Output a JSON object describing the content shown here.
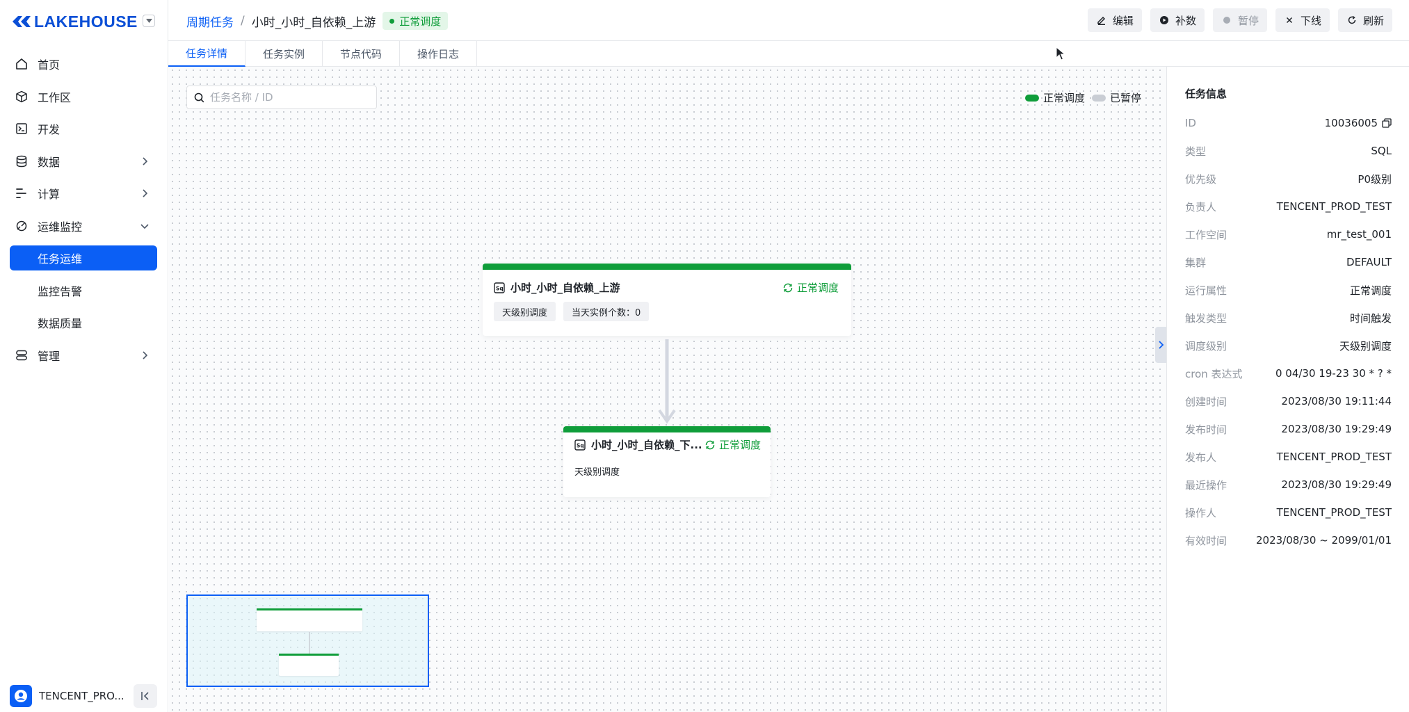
{
  "app": {
    "logo_text": "LAKEHOUSE"
  },
  "sidebar": {
    "items": [
      {
        "label": "首页",
        "icon": "home-icon"
      },
      {
        "label": "工作区",
        "icon": "cube-icon"
      },
      {
        "label": "开发",
        "icon": "terminal-icon"
      },
      {
        "label": "数据",
        "icon": "database-icon",
        "has_children": true
      },
      {
        "label": "计算",
        "icon": "compute-icon",
        "has_children": true
      },
      {
        "label": "运维监控",
        "icon": "monitor-icon",
        "expanded": true
      },
      {
        "label": "任务运维",
        "active": true
      },
      {
        "label": "监控告警"
      },
      {
        "label": "数据质量"
      },
      {
        "label": "管理",
        "icon": "manage-icon",
        "has_children": true
      }
    ],
    "user": {
      "name": "TENCENT_PRO..."
    }
  },
  "header": {
    "breadcrumb_parent": "周期任务",
    "breadcrumb_separator": "/",
    "breadcrumb_current": "小时_小时_自依赖_上游",
    "status_badge": "正常调度",
    "actions": [
      {
        "label": "编辑",
        "icon": "edit-icon"
      },
      {
        "label": "补数",
        "icon": "backfill-icon"
      },
      {
        "label": "暂停",
        "icon": "pause-icon",
        "disabled": true
      },
      {
        "label": "下线",
        "icon": "close-icon"
      },
      {
        "label": "刷新",
        "icon": "refresh-icon"
      }
    ]
  },
  "tabs": [
    {
      "label": "任务详情",
      "active": true
    },
    {
      "label": "任务实例"
    },
    {
      "label": "节点代码"
    },
    {
      "label": "操作日志"
    }
  ],
  "canvas": {
    "search_placeholder": "任务名称 / ID",
    "legend": [
      {
        "label": "正常调度",
        "color": "#0f9d3a"
      },
      {
        "label": "已暂停",
        "color": "#c9cdd4"
      }
    ],
    "nodes": [
      {
        "title": "小时_小时_自依赖_上游",
        "status": "正常调度",
        "chips": [
          "天级别调度",
          "当天实例个数：0"
        ]
      },
      {
        "title": "小时_小时_自依赖_下...",
        "status": "正常调度",
        "detail": "天级别调度"
      }
    ]
  },
  "task_info": {
    "title": "任务信息",
    "rows": [
      {
        "key": "ID",
        "value": "10036005",
        "copyable": true
      },
      {
        "key": "类型",
        "value": "SQL"
      },
      {
        "key": "优先级",
        "value": "P0级别"
      },
      {
        "key": "负责人",
        "value": "TENCENT_PROD_TEST"
      },
      {
        "key": "工作空间",
        "value": "mr_test_001"
      },
      {
        "key": "集群",
        "value": "DEFAULT"
      },
      {
        "key": "运行属性",
        "value": "正常调度"
      },
      {
        "key": "触发类型",
        "value": "时间触发"
      },
      {
        "key": "调度级别",
        "value": "天级别调度"
      },
      {
        "key": "cron 表达式",
        "value": "0 04/30 19-23 30 * ? *"
      },
      {
        "key": "创建时间",
        "value": "2023/08/30 19:11:44"
      },
      {
        "key": "发布时间",
        "value": "2023/08/30 19:29:49"
      },
      {
        "key": "发布人",
        "value": "TENCENT_PROD_TEST"
      },
      {
        "key": "最近操作",
        "value": "2023/08/30 19:29:49"
      },
      {
        "key": "操作人",
        "value": "TENCENT_PROD_TEST"
      },
      {
        "key": "有效时间",
        "value": "2023/08/30 ~ 2099/01/01"
      }
    ]
  },
  "colors": {
    "accent": "#0b5ff5",
    "success": "#0f9d3a",
    "brand": "#0b4fd6"
  }
}
